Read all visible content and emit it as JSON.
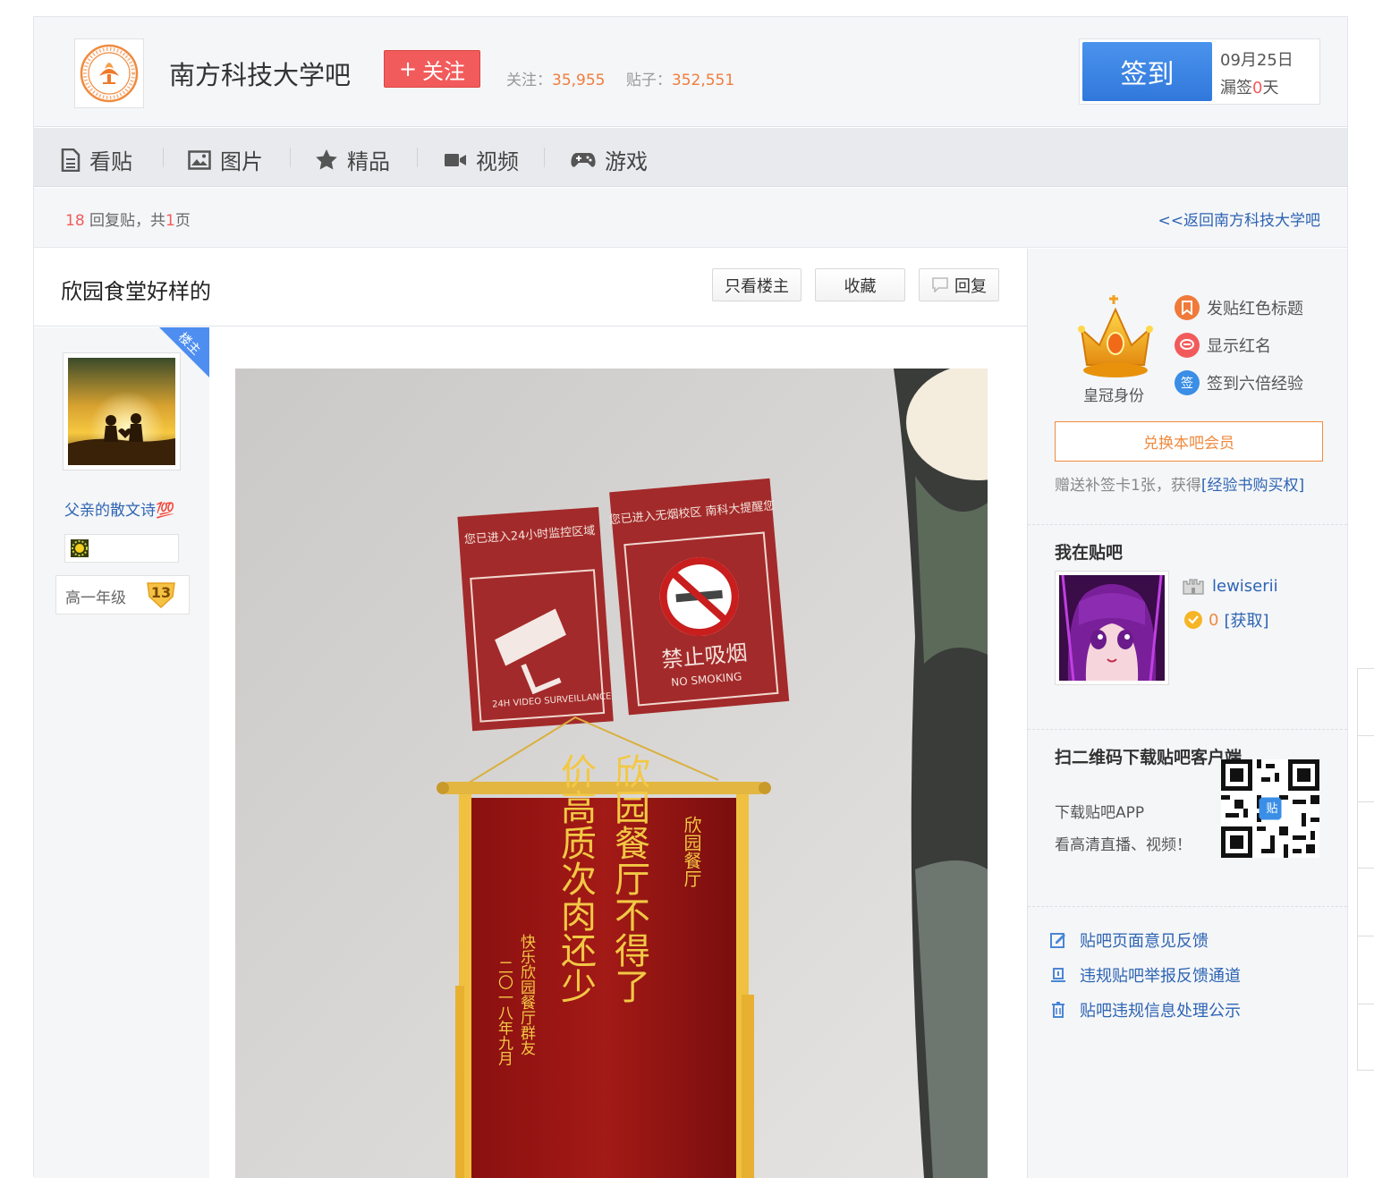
{
  "header": {
    "forum_name": "南方科技大学吧",
    "follow_label": "关注",
    "follow_plus": "+",
    "follow_count_label": "关注：",
    "follow_count": "35,955",
    "post_count_label": "贴子：",
    "post_count": "352,551",
    "sign_label": "签到",
    "sign_date": "09月25日",
    "sign_miss_prefix": "漏签",
    "sign_miss_days": "0",
    "sign_miss_suffix": "天"
  },
  "nav": {
    "items": [
      {
        "label": "看贴",
        "icon": "document-icon"
      },
      {
        "label": "图片",
        "icon": "image-icon"
      },
      {
        "label": "精品",
        "icon": "star-icon"
      },
      {
        "label": "视频",
        "icon": "video-camera-icon"
      },
      {
        "label": "游戏",
        "icon": "gamepad-icon"
      }
    ]
  },
  "thread": {
    "reply_count": "18",
    "reply_text": " 回复贴，共",
    "page_count": "1",
    "page_text": "页",
    "back_link": "<<返回南方科技大学吧",
    "title": "欣园食堂好样的",
    "only_op_label": "只看楼主",
    "favorite_label": "收藏",
    "reply_label": "回复"
  },
  "author": {
    "op_tag": "楼主",
    "name": "父亲的散文诗💯",
    "level_name": "高一年级",
    "level_num": "13"
  },
  "post_image": {
    "sign_cctv_title": "您已进入24小时监控区域",
    "sign_cctv_sub": "24H VIDEO SURVEILLANCE",
    "sign_smoke_title": "您已进入无烟校区 南科大提醒您",
    "sign_smoke_main": "禁止吸烟",
    "sign_smoke_sub": "NO SMOKING",
    "banner_to": "欣园餐厅",
    "banner_line1": "欣园餐厅不得了",
    "banner_line2": "价高质次肉还少",
    "banner_from": "快乐欣园餐厅群友",
    "banner_date": "二〇一八年九月"
  },
  "sidebar": {
    "crown_label": "皇冠身份",
    "perks": [
      {
        "label": "发贴红色标题",
        "color": "#f07a3a"
      },
      {
        "label": "显示红名",
        "color": "#f25b5b"
      },
      {
        "label": "签到六倍经验",
        "color": "#3a8ee6"
      }
    ],
    "perk_icons": [
      "bookmark-icon",
      "chat-icon",
      "sign-icon"
    ],
    "perk3_glyph": "签",
    "exchange_label": "兑换本吧会员",
    "gift_text": "赠送补签卡1张，获得",
    "gift_link": "[经验书购买权]",
    "me_title": "我在贴吧",
    "me_name": "lewiserii",
    "me_points": "0",
    "me_get": "[获取]",
    "qr_title": "扫二维码下载贴吧客户端",
    "app_line1": "下载贴吧APP",
    "app_line2": "看高清直播、视频！",
    "qr_badge": "贴",
    "links": [
      {
        "label": "贴吧页面意见反馈",
        "icon": "edit-icon"
      },
      {
        "label": "违规贴吧举报反馈通道",
        "icon": "report-icon"
      },
      {
        "label": "贴吧违规信息处理公示",
        "icon": "trash-icon"
      }
    ]
  }
}
